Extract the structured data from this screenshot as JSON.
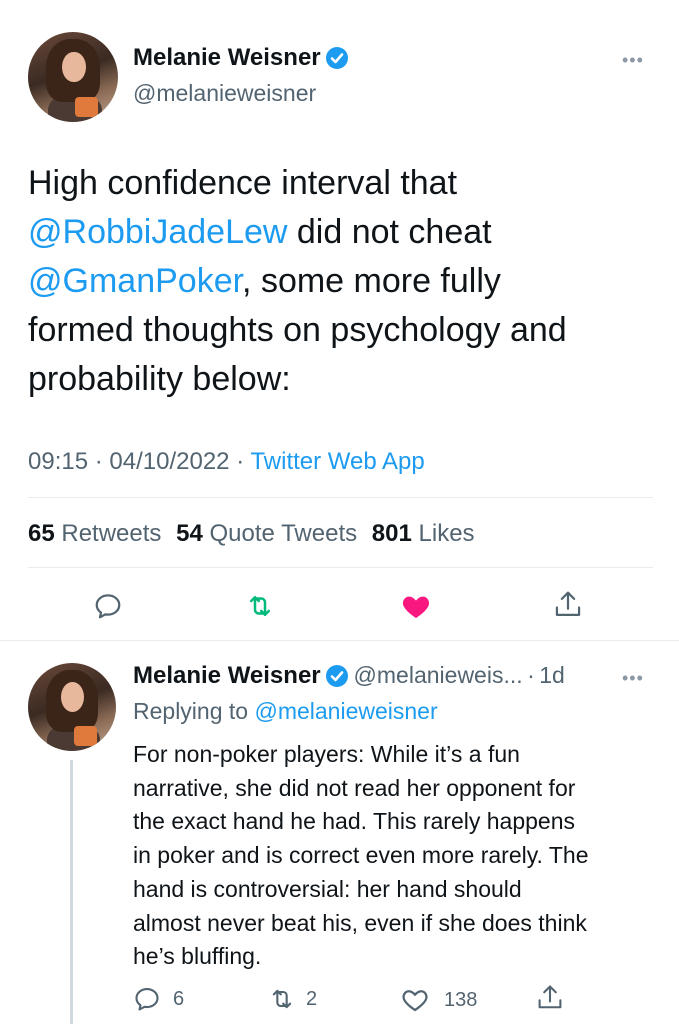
{
  "main_tweet": {
    "author_name": "Melanie Weisner",
    "author_handle": "@melanieweisner",
    "text_parts": {
      "line1": "High confidence interval that",
      "mention1": "@RobbiJadeLew",
      "line2_rest": " did not cheat",
      "mention2": "@GmanPoker",
      "line3_rest": ", some more fully",
      "line4": "formed thoughts on psychology and",
      "line5": "probability below:"
    },
    "time": "09:15",
    "date": "04/10/2022",
    "source": "Twitter Web App",
    "sep": "·",
    "stats": {
      "retweets_count": "65",
      "retweets_label": "Retweets",
      "quotes_count": "54",
      "quotes_label": "Quote Tweets",
      "likes_count": "801",
      "likes_label": "Likes"
    },
    "more_label": "•••"
  },
  "reply": {
    "author_name": "Melanie Weisner",
    "author_handle": "@melanieweis...",
    "sep": "·",
    "age": "1d",
    "replying_prefix": "Replying to",
    "replying_to": "@melanieweisner",
    "lines": [
      "For non-poker players: While it’s a fun",
      "narrative, she did not read her opponent for",
      "the exact hand he had. This rarely happens",
      "in poker and is correct even more rarely. The",
      "hand is controversial: her hand should",
      "almost never beat his, even if she does think",
      "he’s bluffing."
    ],
    "reply_count": "6",
    "retweet_count": "2",
    "like_count": "138",
    "more_label": "•••"
  },
  "colors": {
    "accent": "#1d9bf0",
    "like_active": "#f91880",
    "retweet_active": "#00ba7c",
    "muted": "#536471"
  },
  "icons": [
    "verified-icon",
    "reply-icon",
    "retweet-icon",
    "heart-icon",
    "share-icon",
    "more-icon"
  ]
}
